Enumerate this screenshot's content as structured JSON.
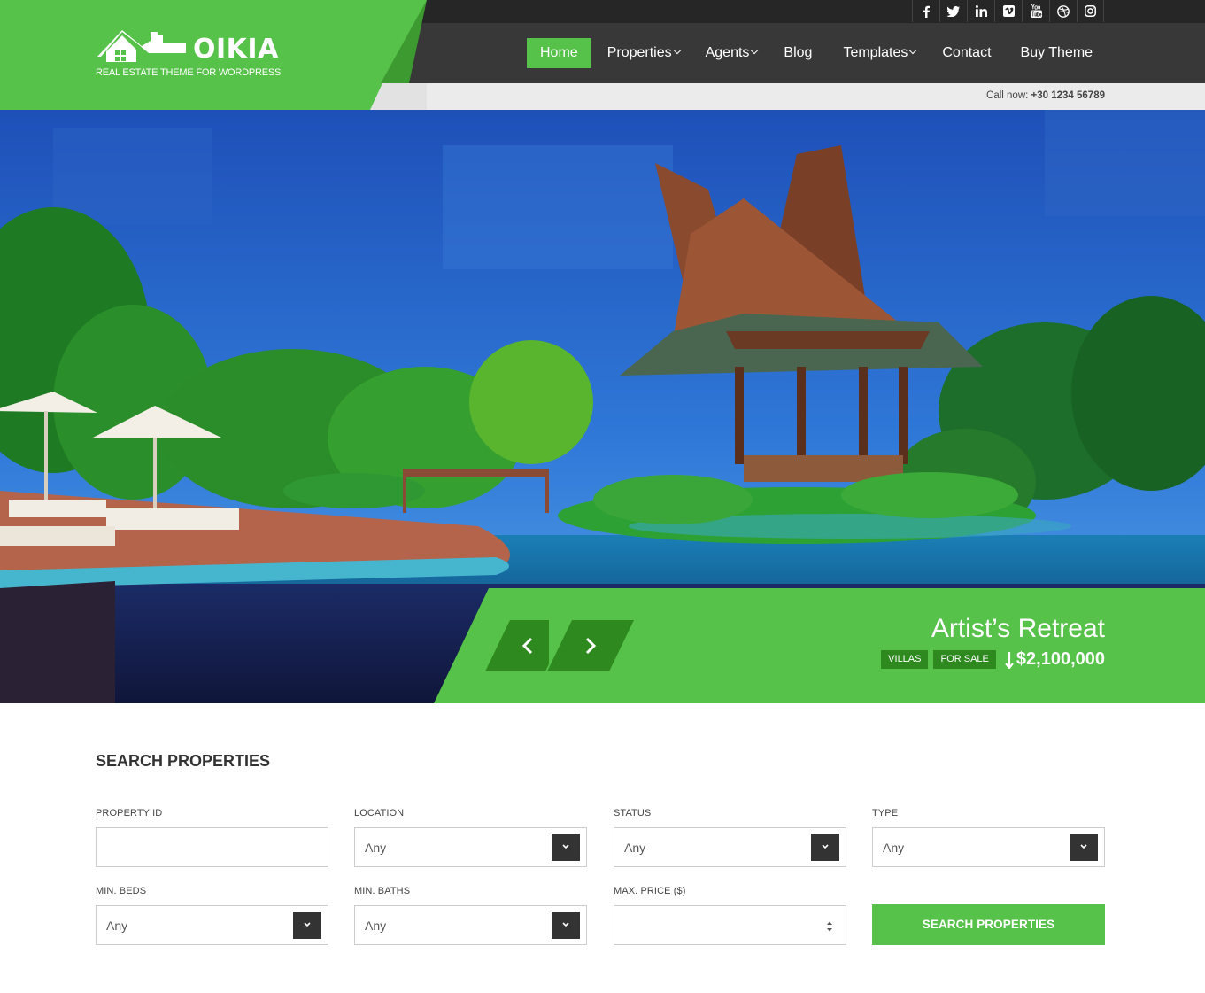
{
  "brand": {
    "name": "OIKIA",
    "tagline": "REAL ESTATE THEME FOR WORDPRESS",
    "accent_color": "#56c24a",
    "dark_color": "#383838"
  },
  "social": [
    "facebook-icon",
    "twitter-icon",
    "linkedin-icon",
    "vimeo-icon",
    "youtube-icon",
    "dribbble-icon",
    "instagram-icon"
  ],
  "nav": {
    "home": "Home",
    "properties": "Properties",
    "agents": "Agents",
    "blog": "Blog",
    "templates": "Templates",
    "contact": "Contact",
    "buy_theme": "Buy Theme"
  },
  "call": {
    "label": "Call now:",
    "number": "+30 1234 56789"
  },
  "slide": {
    "title": "Artist’s Retreat",
    "tags": [
      "VILLAS",
      "FOR SALE"
    ],
    "price": "$2,100,000"
  },
  "search": {
    "title": "SEARCH PROPERTIES",
    "property_id_label": "PROPERTY ID",
    "location_label": "LOCATION",
    "location_value": "Any",
    "status_label": "STATUS",
    "status_value": "Any",
    "type_label": "TYPE",
    "type_value": "Any",
    "min_beds_label": "MIN. BEDS",
    "min_beds_value": "Any",
    "min_baths_label": "MIN. BATHS",
    "min_baths_value": "Any",
    "max_price_label": "MAX. PRICE ($)",
    "button": "SEARCH PROPERTIES"
  }
}
